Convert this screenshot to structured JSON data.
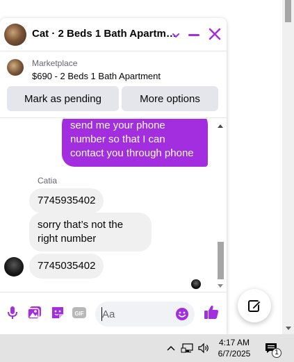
{
  "chat": {
    "title": "Cat · 2 Beds 1 Bath Apartm…",
    "accent": "#a22ee0"
  },
  "marketplace": {
    "label": "Marketplace",
    "listing": "$690 - 2 Beds 1 Bath Apartment",
    "mark_pending": "Mark as pending",
    "more_options": "More options"
  },
  "messages": {
    "outgoing": "send me your phone number so that I can contact you through phone",
    "sender_name": "Catia",
    "incoming": [
      "7745935402",
      "sorry that’s not the right number",
      "7745035402"
    ]
  },
  "composer": {
    "placeholder": "Aa",
    "icons": [
      "microphone-icon",
      "photo-icon",
      "sticker-icon",
      "gif-icon",
      "emoji-icon",
      "like-icon"
    ]
  },
  "taskbar": {
    "time": "4:17 AM",
    "date": "6/7/2025",
    "notification_count": "1"
  }
}
